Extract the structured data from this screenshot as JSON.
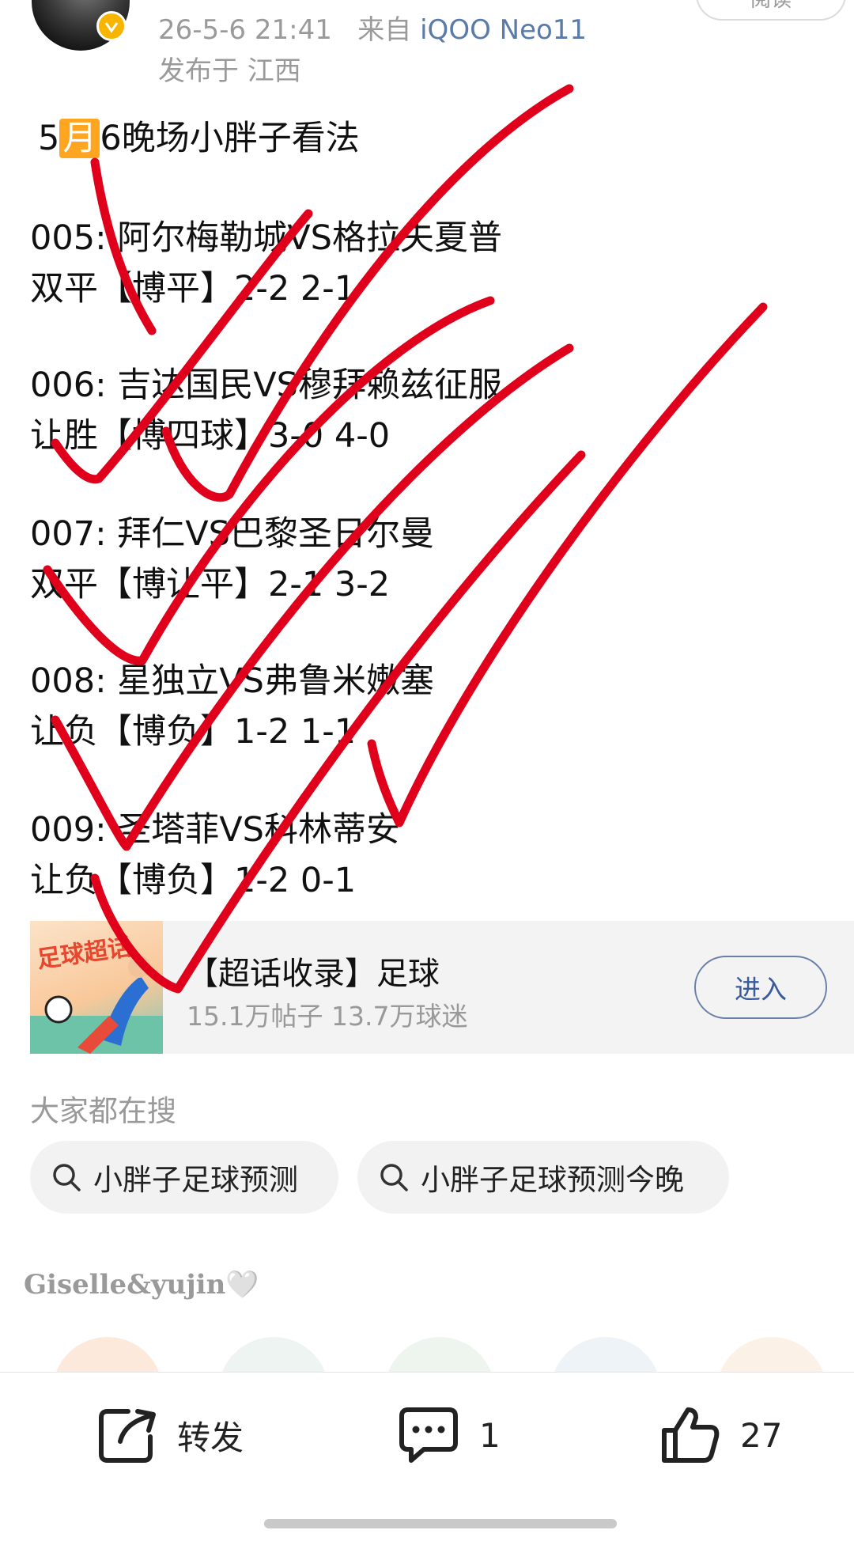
{
  "header": {
    "datetime": "26-5-6 21:41",
    "from_label": "来自",
    "device": "iQOO Neo11",
    "location": "发布于 江西",
    "read_button": "阅读"
  },
  "post": {
    "title_prefix": "5",
    "title_highlight": "月",
    "title_suffix": "6晚场小胖子看法",
    "lines": [
      "005: 阿尔梅勒城VS格拉夫夏普",
      "双平【博平】2-2  2-1",
      "006: 吉达国民VS穆拜赖兹征服",
      "让胜【博四球】3-0  4-0",
      "007: 拜仁VS巴黎圣日尔曼",
      "双平【博让平】2-1  3-2",
      "008: 星独立VS弗鲁米嫩塞",
      "让负【博负】1-2  1-1",
      "009: 圣塔菲VS科林蒂安",
      "让负【博负】1-2 0-1"
    ]
  },
  "card": {
    "image_text": "足球超话",
    "title": "【超话收录】足球",
    "subtitle": "15.1万帖子 13.7万球迷",
    "enter_label": "进入"
  },
  "search": {
    "heading": "大家都在搜",
    "chips": [
      "小胖子足球预测",
      "小胖子足球预测今晚"
    ]
  },
  "signature": "Giselle&yujin🤍",
  "actions": {
    "repost_label": "转发",
    "comment_count": "1",
    "like_count": "27"
  },
  "colors": {
    "ink": "#e0001b",
    "accent_orange": "#ffa51f",
    "link_blue": "#5a7aa8"
  }
}
